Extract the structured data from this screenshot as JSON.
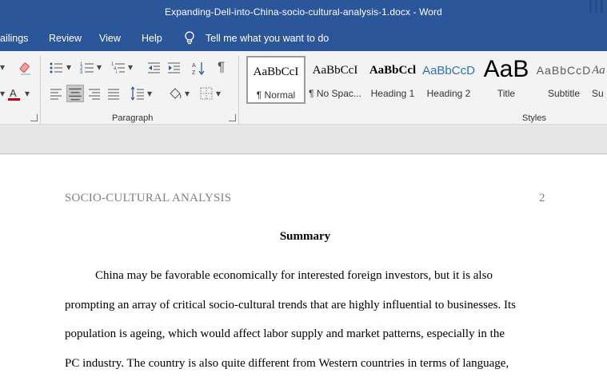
{
  "window": {
    "title": "Expanding-Dell-into-China-socio-cultural-analysis-1.docx  -  Word"
  },
  "menu": {
    "tabs": [
      "ailings",
      "Review",
      "View",
      "Help"
    ],
    "tell_me": "Tell me what you want to do"
  },
  "ribbon": {
    "paragraph_label": "Paragraph",
    "styles_label": "Styles",
    "styles": [
      {
        "sample": "AaBbCcI",
        "name": "¶ Normal"
      },
      {
        "sample": "AaBbCcI",
        "name": "¶ No Spac..."
      },
      {
        "sample": "AaBbCcl",
        "name": "Heading 1"
      },
      {
        "sample": "AaBbCcD",
        "name": "Heading 2"
      },
      {
        "sample": "AaB",
        "name": "Title"
      },
      {
        "sample": "AaBbCcD",
        "name": "Subtitle"
      },
      {
        "sample": "Aa",
        "name": "Su"
      }
    ]
  },
  "document": {
    "header_left": "SOCIO-CULTURAL ANALYSIS",
    "page_number": "2",
    "heading": "Summary",
    "lines": [
      "China may be favorable economically for interested foreign investors, but it is also",
      "prompting an array of critical socio-cultural trends that are highly influential to businesses. Its",
      "population is ageing, which would affect labor supply and market patterns, especially in the",
      "PC industry. The country is also quite different from Western countries in terms of language,"
    ]
  },
  "colors": {
    "word_blue": "#2b579a",
    "ribbon_bg": "#f3f3f3",
    "header_gray": "#808080",
    "font_color_red": "#c00000",
    "heading_blue": "#2e74b5"
  }
}
